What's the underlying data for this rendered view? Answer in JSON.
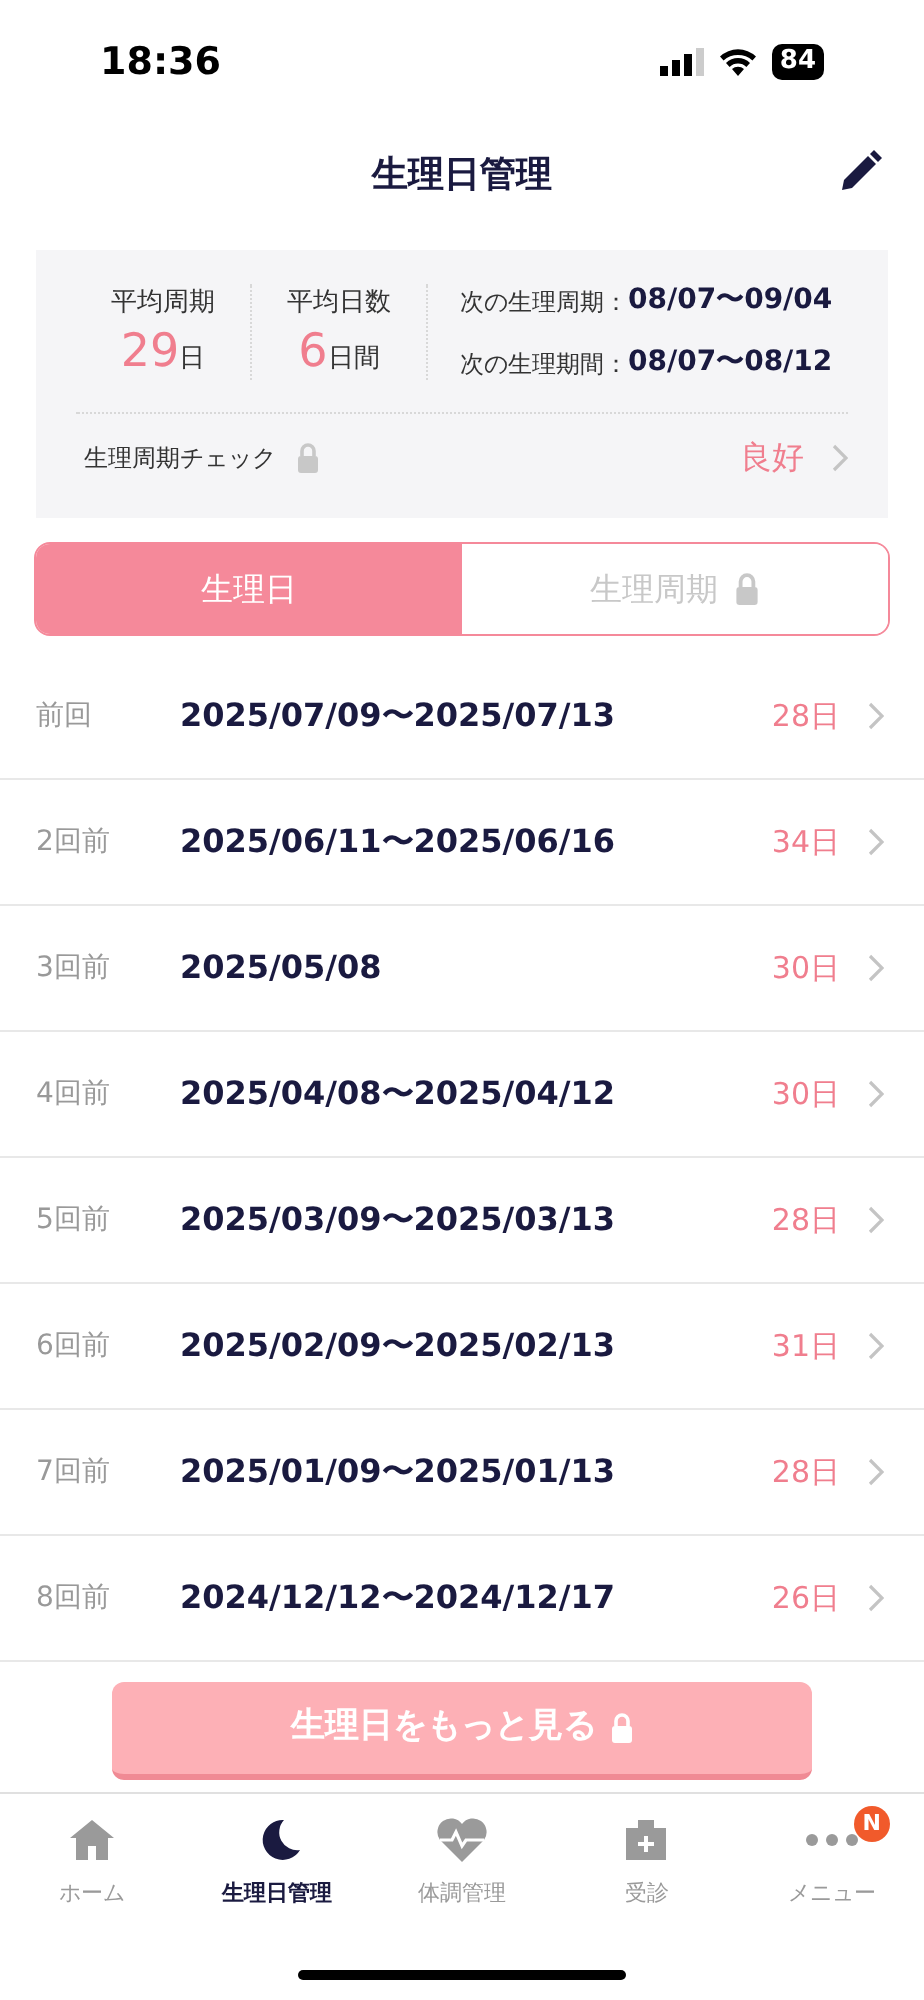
{
  "status_bar": {
    "time": "18:36",
    "battery": "84"
  },
  "header": {
    "title": "生理日管理"
  },
  "summary": {
    "avg_cycle": {
      "label": "平均周期",
      "value": "29",
      "unit": "日"
    },
    "avg_days": {
      "label": "平均日数",
      "value": "6",
      "unit": "日間"
    },
    "next": [
      {
        "label": "次の生理周期：",
        "value": "08/07〜09/04"
      },
      {
        "label": "次の生理期間：",
        "value": "08/07〜08/12"
      }
    ],
    "check": {
      "label": "生理周期チェック",
      "locked": true,
      "result": "良好"
    }
  },
  "tabs": [
    {
      "label": "生理日",
      "selected": true,
      "locked": false
    },
    {
      "label": "生理周期",
      "selected": false,
      "locked": true
    }
  ],
  "periods": [
    {
      "label": "前回",
      "dates": "2025/07/09〜2025/07/13",
      "days": "28日"
    },
    {
      "label": "2回前",
      "dates": "2025/06/11〜2025/06/16",
      "days": "34日"
    },
    {
      "label": "3回前",
      "dates": "2025/05/08",
      "days": "30日"
    },
    {
      "label": "4回前",
      "dates": "2025/04/08〜2025/04/12",
      "days": "30日"
    },
    {
      "label": "5回前",
      "dates": "2025/03/09〜2025/03/13",
      "days": "28日"
    },
    {
      "label": "6回前",
      "dates": "2025/02/09〜2025/02/13",
      "days": "31日"
    },
    {
      "label": "7回前",
      "dates": "2025/01/09〜2025/01/13",
      "days": "28日"
    },
    {
      "label": "8回前",
      "dates": "2024/12/12〜2024/12/17",
      "days": "26日"
    }
  ],
  "more_button": {
    "label": "生理日をもっと見る",
    "locked": true
  },
  "nav": [
    {
      "kind": "home",
      "label": "ホーム",
      "selected": false
    },
    {
      "kind": "moon",
      "label": "生理日管理",
      "selected": true
    },
    {
      "kind": "heart",
      "label": "体調管理",
      "selected": false
    },
    {
      "kind": "clinic",
      "label": "受診",
      "selected": false
    },
    {
      "kind": "menu",
      "label": "メニュー",
      "selected": false,
      "badge": "N"
    }
  ]
}
